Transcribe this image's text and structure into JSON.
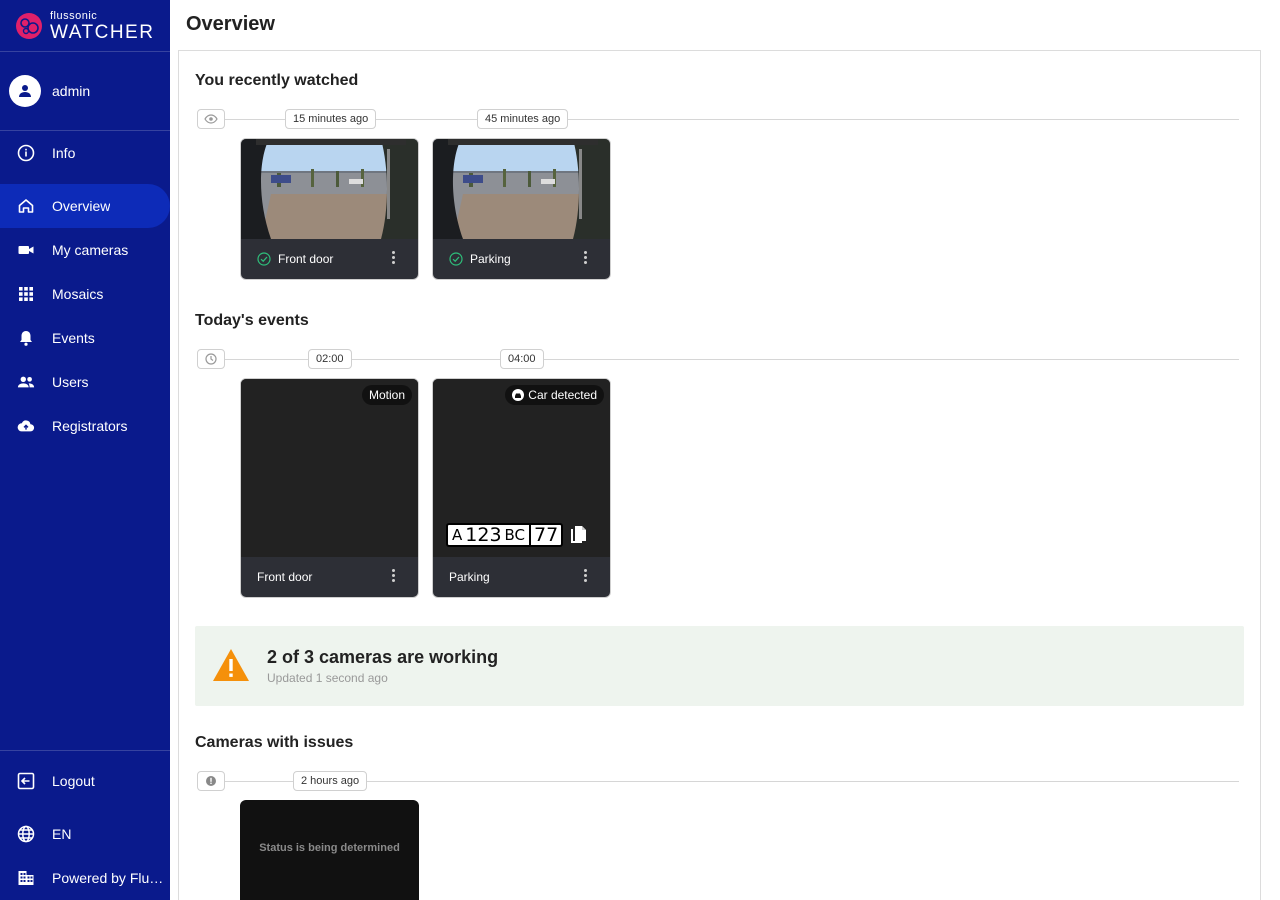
{
  "app": {
    "brand_small": "flussonic",
    "brand_big": "WATCHER",
    "page_title": "Overview"
  },
  "sidebar": {
    "user": "admin",
    "items": [
      {
        "label": "Info",
        "icon": "info-icon"
      },
      {
        "label": "Overview",
        "icon": "home-icon",
        "active": true
      },
      {
        "label": "My cameras",
        "icon": "camera-icon"
      },
      {
        "label": "Mosaics",
        "icon": "grid-icon"
      },
      {
        "label": "Events",
        "icon": "bell-icon"
      },
      {
        "label": "Users",
        "icon": "users-icon"
      },
      {
        "label": "Registrators",
        "icon": "cloud-upload-icon"
      }
    ],
    "bottom": [
      {
        "label": "Logout",
        "icon": "logout-icon"
      },
      {
        "label": "EN",
        "icon": "globe-icon"
      },
      {
        "label": "Powered by Flu…",
        "icon": "building-icon"
      }
    ]
  },
  "recent": {
    "title": "You recently watched",
    "cards": [
      {
        "time": "15 minutes ago",
        "name": "Front door"
      },
      {
        "time": "45 minutes ago",
        "name": "Parking"
      }
    ]
  },
  "events": {
    "title": "Today's events",
    "cards": [
      {
        "time": "02:00",
        "name": "Front door",
        "badge": "Motion"
      },
      {
        "time": "04:00",
        "name": "Parking",
        "badge": "Car detected",
        "plate": {
          "letter1": "A",
          "digits": "123",
          "letters2": "BC",
          "region": "77"
        }
      }
    ]
  },
  "status": {
    "title": "2 of 3 cameras are working",
    "subtitle": "Updated 1 second ago"
  },
  "issues": {
    "title": "Cameras with issues",
    "cards": [
      {
        "time": "2 hours ago",
        "status": "Status is being determined"
      }
    ]
  },
  "colors": {
    "sidebar_bg": "#0a1a8c",
    "active_item": "#0d2bb8",
    "brand_pink": "#e0206a",
    "ok_green": "#2ebd7a",
    "warning": "#f5900b"
  }
}
